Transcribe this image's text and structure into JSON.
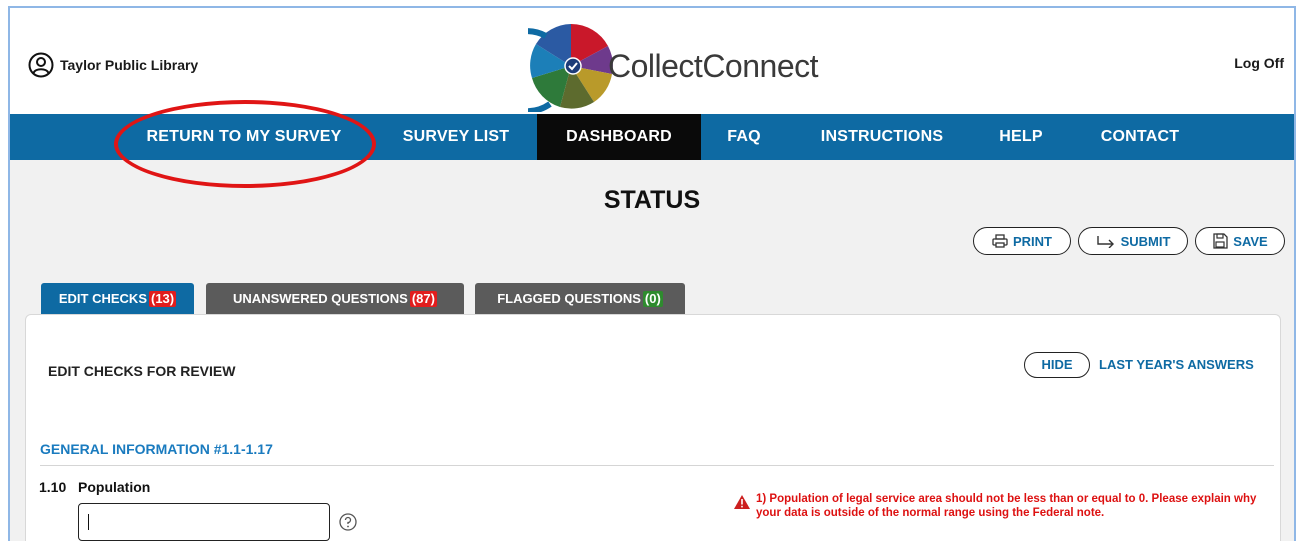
{
  "header": {
    "org_name": "Taylor Public Library",
    "app_name": "CollectConnect",
    "logoff_label": "Log Off"
  },
  "nav": {
    "items": [
      {
        "label": "RETURN TO MY SURVEY"
      },
      {
        "label": "SURVEY LIST"
      },
      {
        "label": "DASHBOARD",
        "active": true
      },
      {
        "label": "FAQ"
      },
      {
        "label": "INSTRUCTIONS"
      },
      {
        "label": "HELP"
      },
      {
        "label": "CONTACT"
      }
    ],
    "highlight": "RETURN TO MY SURVEY"
  },
  "page": {
    "title": "STATUS"
  },
  "actions": {
    "print_label": "PRINT",
    "submit_label": "SUBMIT",
    "save_label": "SAVE"
  },
  "tabs": [
    {
      "label": "EDIT CHECKS",
      "count": "(13)",
      "color": "#0e6aa3",
      "badge_color": "#e11d1d"
    },
    {
      "label": "UNANSWERED QUESTIONS",
      "count": "(87)",
      "color": "#5b5b5b",
      "badge_color": "#e11d1d"
    },
    {
      "label": "FLAGGED QUESTIONS",
      "count": "(0)",
      "color": "#5b5b5b",
      "badge_color": "#2e8b2e"
    }
  ],
  "panel": {
    "heading": "EDIT CHECKS FOR REVIEW",
    "hide_label": "HIDE",
    "last_year_label": "LAST YEAR'S ANSWERS",
    "section_title": "GENERAL INFORMATION #1.1-1.17",
    "question": {
      "number": "1.10",
      "label": "Population",
      "value": ""
    },
    "warning": "1) Population of legal service area should not be less than or equal to 0. Please explain why your data is outside of the normal range using the Federal note."
  },
  "colors": {
    "nav_bg": "#0e6aa3",
    "active_nav_bg": "#0a0a0a",
    "accent_blue": "#0e6aa3",
    "highlight_red": "#e01515",
    "warning_red": "#d11111"
  }
}
